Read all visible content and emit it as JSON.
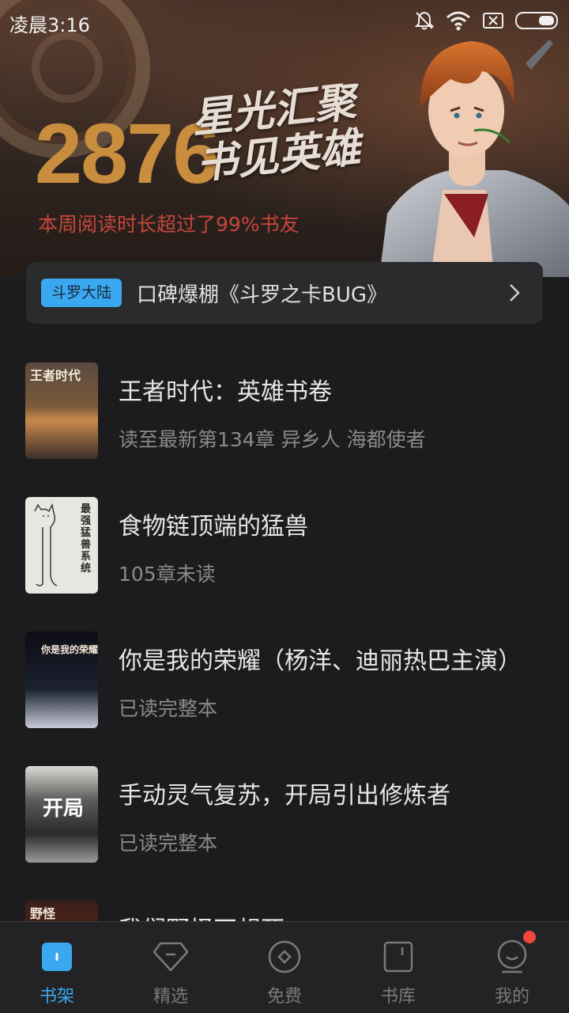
{
  "status_bar": {
    "time": "凌晨3:16"
  },
  "banner": {
    "reading_time_number": "2876",
    "slogan_line1": "星光汇聚",
    "slogan_line2": "书见英雄",
    "subtitle": "本周阅读时长超过了99%书友"
  },
  "notice": {
    "tag": "斗罗大陆",
    "text": "口碑爆棚《斗罗之卡BUG》"
  },
  "books": [
    {
      "title": "王者时代：英雄书卷",
      "subtitle": "读至最新第134章 异乡人 海都使者",
      "cover_text": "王者时代"
    },
    {
      "title": "食物链顶端的猛兽",
      "subtitle": "105章未读",
      "cover_text": "最强猛兽系统"
    },
    {
      "title": "你是我的荣耀（杨洋、迪丽热巴主演）",
      "subtitle": "已读完整本",
      "cover_text": "你是我的荣耀"
    },
    {
      "title": "手动灵气复苏，开局引出修炼者",
      "subtitle": "已读完整本",
      "cover_text": "开局"
    },
    {
      "title": "我们野怪不想死",
      "subtitle": "",
      "cover_text": "野怪"
    }
  ],
  "tabs": [
    {
      "label": "书架",
      "icon": "bookshelf-icon",
      "active": true
    },
    {
      "label": "精选",
      "icon": "gem-icon",
      "active": false
    },
    {
      "label": "免费",
      "icon": "coin-icon",
      "active": false
    },
    {
      "label": "书库",
      "icon": "library-icon",
      "active": false
    },
    {
      "label": "我的",
      "icon": "profile-icon",
      "active": false,
      "badge": true
    }
  ],
  "colors": {
    "accent": "#3aa8f0",
    "background": "#1c1c1e",
    "banner_number": "#c98d3e",
    "banner_subtitle": "#c6463a",
    "badge": "#f0483c"
  }
}
